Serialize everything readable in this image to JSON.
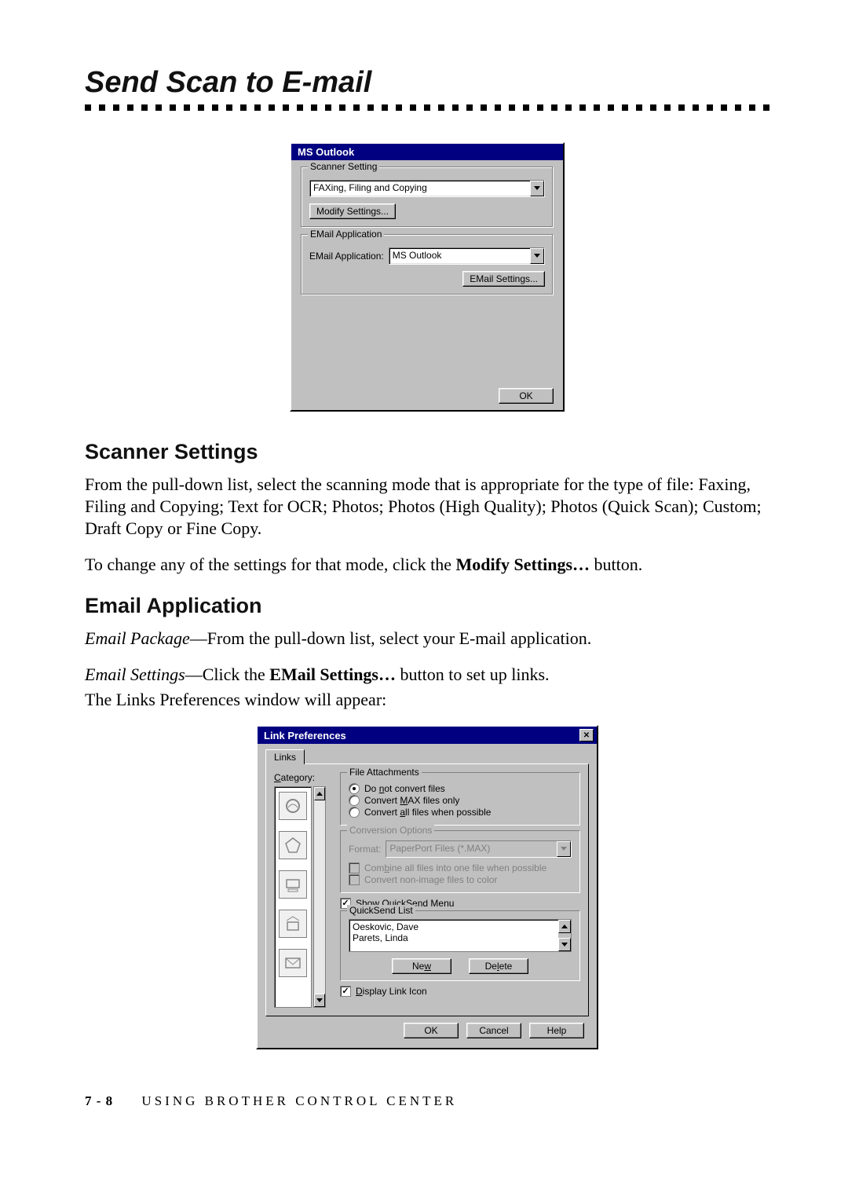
{
  "title": "Send Scan to E-mail",
  "msOutlook": {
    "windowTitle": "MS Outlook",
    "scannerLegend": "Scanner Setting",
    "scannerSelect": "FAXing, Filing and Copying",
    "modifyBtn": "Modify Settings...",
    "emailLegend": "EMail Application",
    "emailLabel": "EMail Application:",
    "emailSelect": "MS Outlook",
    "emailSettingsBtn": "EMail Settings...",
    "okBtn": "OK"
  },
  "scannerSettings": {
    "heading": "Scanner Settings",
    "p1": "From the pull-down list, select the scanning mode that is appropriate for the type of file:  Faxing, Filing and Copying; Text for OCR; Photos; Photos (High Quality); Photos (Quick Scan); Custom; Draft Copy or Fine Copy.",
    "p2a": "To change any of the settings for that mode, click the ",
    "p2b": "Modify Settings…",
    "p2c": " button."
  },
  "emailApp": {
    "heading": "Email Application",
    "p1a": "Email Package",
    "p1b": "—From the pull-down list, select your E-mail application.",
    "p2a": "Email Settings",
    "p2b": "—Click the ",
    "p2c": "EMail Settings…",
    "p2d": " button to set up links.",
    "p3": "The Links Preferences window will appear:"
  },
  "linkPrefs": {
    "windowTitle": "Link Preferences",
    "tab": "Links",
    "categoryLabel": "Category:",
    "fileAttachLegend": "File Attachments",
    "radio1": "Do not convert files",
    "radio2": "Convert MAX files only",
    "radio3": "Convert all files when possible",
    "convLegend": "Conversion Options",
    "formatLabel": "Format:",
    "formatValue": "PaperPort Files (*.MAX)",
    "check1": "Combine all files into one file when possible",
    "check2": "Convert non-image files to color",
    "quickSendCheck": "Show QuickSend Menu",
    "quickSendLegend": "QuickSend List",
    "quickItems": [
      "Oeskovic, Dave",
      "Parets, Linda"
    ],
    "newBtn": "New",
    "deleteBtn": "Delete",
    "displayLinkCheck": "Display Link Icon",
    "okBtn": "OK",
    "cancelBtn": "Cancel",
    "helpBtn": "Help"
  },
  "footer": {
    "page": "7 - 8",
    "text": "USING BROTHER CONTROL CENTER"
  }
}
